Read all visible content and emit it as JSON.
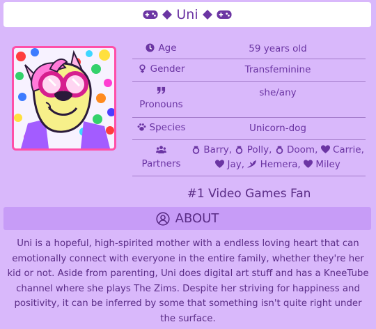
{
  "header": {
    "name": "Uni",
    "left_icons": [
      "gamepad-icon",
      "diamond-icon"
    ],
    "right_icons": [
      "diamond-icon",
      "gamepad-icon"
    ]
  },
  "profile": {
    "avatar": "character-avatar",
    "rows": [
      {
        "key": "Age",
        "icon": "clock-icon",
        "value": "59 years old"
      },
      {
        "key": "Gender",
        "icon": "venus-icon",
        "value": "Transfeminine"
      },
      {
        "key": "Pronouns",
        "icon": "quote-icon",
        "value": "she/any"
      },
      {
        "key": "Species",
        "icon": "paw-icon",
        "value": "Unicorn-dog"
      },
      {
        "key": "Partners",
        "icon": "users-icon",
        "partners": [
          {
            "name": "Barry",
            "icon": "ring-icon"
          },
          {
            "name": "Polly",
            "icon": "ring-icon"
          },
          {
            "name": "Doom",
            "icon": "ring-icon"
          },
          {
            "name": "Carrie",
            "icon": "heart-icon"
          },
          {
            "name": "Jay",
            "icon": "heart-icon"
          },
          {
            "name": "Hemera",
            "icon": "feather-icon"
          },
          {
            "name": "Miley",
            "icon": "heart-icon"
          }
        ]
      }
    ],
    "tagline": "#1 Video Games Fan"
  },
  "about": {
    "heading": "ABOUT",
    "icon": "user-circle-icon",
    "text": "Uni is a hopeful, high-spirited mother with a endless loving heart that can emotionally connect with everyone in the entire family, whether they're her kid or not. Aside from parenting, Uni does digital art stuff and has a KneeTube channel where she plays The Zims. Despite her striving for happiness and positivity, it can be inferred by some that something isn't quite right under the surface."
  },
  "colors": {
    "background": "#d9b8fb",
    "text": "#5a2c86",
    "accent": "#c79cf7",
    "frame": "#ff4fa8"
  }
}
